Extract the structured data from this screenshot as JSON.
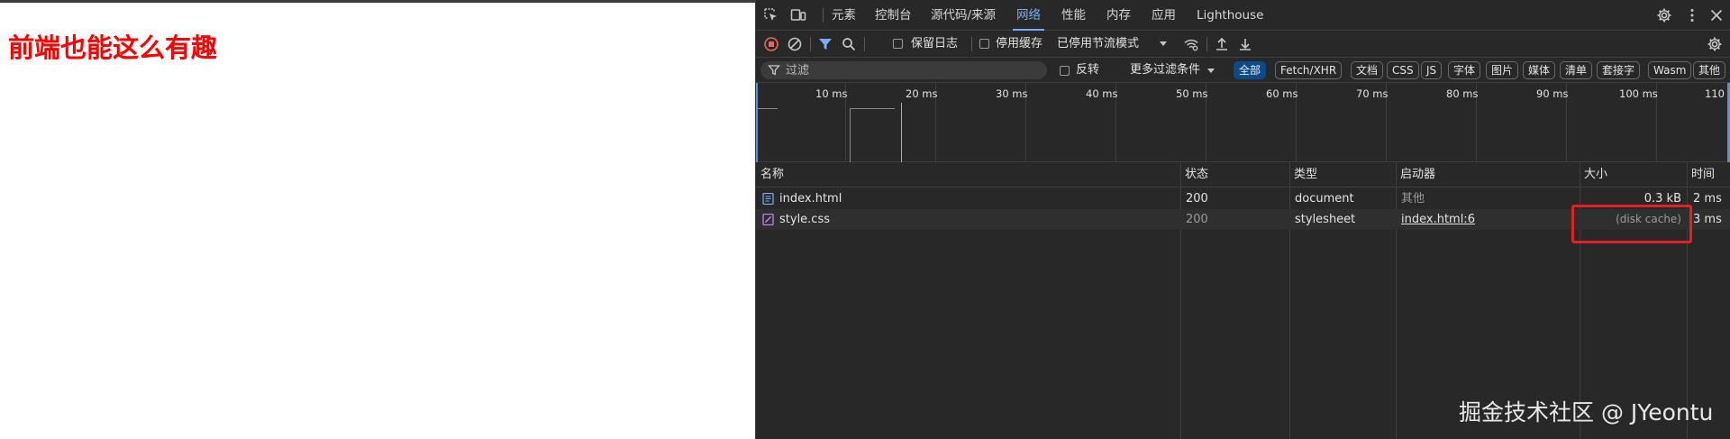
{
  "page": {
    "heading": "前端也能这么有趣"
  },
  "devtools": {
    "tabs": [
      {
        "label": "元素"
      },
      {
        "label": "控制台"
      },
      {
        "label": "源代码/来源"
      },
      {
        "label": "网络"
      },
      {
        "label": "性能"
      },
      {
        "label": "内存"
      },
      {
        "label": "应用"
      },
      {
        "label": "Lighthouse"
      }
    ],
    "active_tab": "网络",
    "toolbar": {
      "preserve_log_label": "保留日志",
      "disable_cache_label": "停用缓存",
      "throttling_value": "已停用节流模式"
    },
    "filter": {
      "placeholder": "过滤",
      "invert_label": "反转",
      "more_filters_label": "更多过滤条件",
      "chips": [
        "全部",
        "Fetch/XHR",
        "文档",
        "CSS",
        "JS",
        "字体",
        "图片",
        "媒体",
        "清单",
        "套接字",
        "Wasm",
        "其他"
      ]
    },
    "overview": {
      "ticks": [
        "10 ms",
        "20 ms",
        "30 ms",
        "40 ms",
        "50 ms",
        "60 ms",
        "70 ms",
        "80 ms",
        "90 ms",
        "100 ms",
        "110"
      ]
    },
    "table": {
      "columns": [
        "名称",
        "状态",
        "类型",
        "启动器",
        "大小",
        "时间"
      ],
      "rows": [
        {
          "name": "index.html",
          "status": "200",
          "type": "document",
          "initiator": "其他",
          "size": "0.3 kB",
          "time": "2 ms"
        },
        {
          "name": "style.css",
          "status": "200",
          "type": "stylesheet",
          "initiator": "index.html:6",
          "size": "(disk cache)",
          "time": "3 ms"
        }
      ]
    }
  },
  "watermark": "掘金技术社区 @ JYeontu",
  "colors": {
    "heading": "#ff0000",
    "active_tab": "#7cacf8",
    "highlight": "#e81f1f",
    "record": "#e46962",
    "filter_icon": "#7cacf8"
  }
}
